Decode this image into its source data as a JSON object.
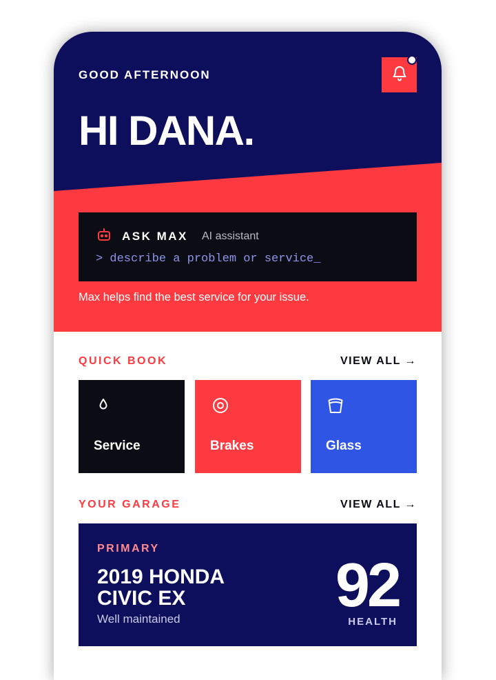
{
  "header": {
    "greeting": "GOOD AFTERNOON",
    "title": "HI DANA.",
    "notification_icon": "bell-icon",
    "has_unread": true
  },
  "assistant": {
    "title": "ASK MAX",
    "subtitle": "AI assistant",
    "prompt": "> describe a problem or service_",
    "helper_text": "Max helps find the best service for your issue.",
    "icon": "robot-icon"
  },
  "quick_book": {
    "label": "QUICK BOOK",
    "view_all": "VIEW ALL →",
    "tiles": [
      {
        "label": "Service",
        "icon": "oil-drop-icon",
        "color": "#0b0c14"
      },
      {
        "label": "Brakes",
        "icon": "brake-disc-icon",
        "color": "#fe3a41"
      },
      {
        "label": "Glass",
        "icon": "windshield-icon",
        "color": "#2f55e4"
      }
    ]
  },
  "garage": {
    "label": "YOUR GARAGE",
    "view_all": "VIEW ALL →",
    "vehicle": {
      "tag": "PRIMARY",
      "name": "2019 HONDA CIVIC EX",
      "status": "Well maintained",
      "health_score": "92",
      "health_label": "HEALTH"
    }
  },
  "colors": {
    "navy": "#0d0f5c",
    "red": "#fe3a41",
    "blue": "#2f55e4",
    "black": "#0b0c14"
  }
}
